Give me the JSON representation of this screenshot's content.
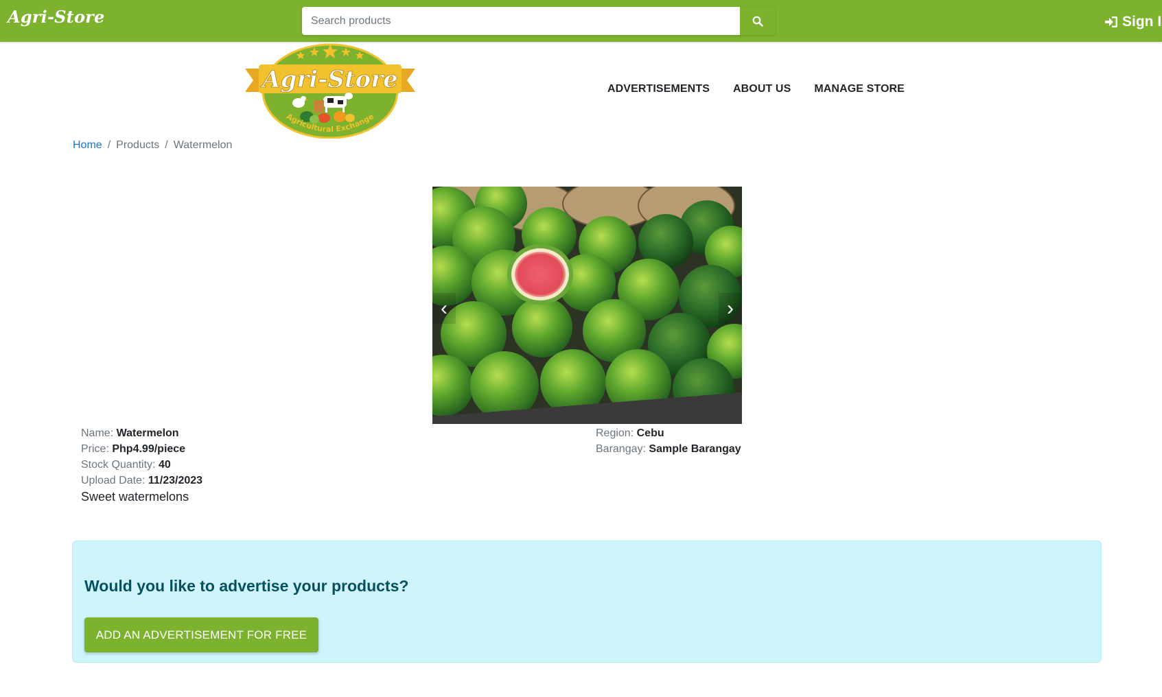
{
  "topbar": {
    "brand": "Agri-Store",
    "search_placeholder": "Search products",
    "signin_label": "Sign In"
  },
  "logo": {
    "title": "Agri-Store",
    "tagline": "Agricultural Exchange"
  },
  "nav": {
    "items": [
      {
        "label": "ADVERTISEMENTS"
      },
      {
        "label": "ABOUT US"
      },
      {
        "label": "MANAGE STORE"
      }
    ]
  },
  "breadcrumb": {
    "home": "Home",
    "products": "Products",
    "current": "Watermelon",
    "separator": "/"
  },
  "carousel": {
    "prev_icon": "‹",
    "next_icon": "›",
    "image_subject": "watermelons"
  },
  "product": {
    "name_label": "Name:",
    "name": "Watermelon",
    "price_label": "Price:",
    "price": "Php4.99/piece",
    "stock_label": "Stock Quantity:",
    "stock": "40",
    "upload_label": "Upload Date:",
    "upload_date": "11/23/2023",
    "region_label": "Region:",
    "region": "Cebu",
    "barangay_label": "Barangay:",
    "barangay": "Sample Barangay",
    "description": "Sweet watermelons"
  },
  "promo": {
    "title": "Would you like to advertise your products?",
    "button_label": "ADD AN ADVERTISEMENT FOR FREE"
  },
  "colors": {
    "brand_green": "#7cb22e",
    "alert_bg": "#cff4fc",
    "alert_text": "#055160",
    "link_blue": "#1976d2"
  },
  "icons": {
    "search": "search-icon",
    "signin": "sign-in-icon"
  }
}
